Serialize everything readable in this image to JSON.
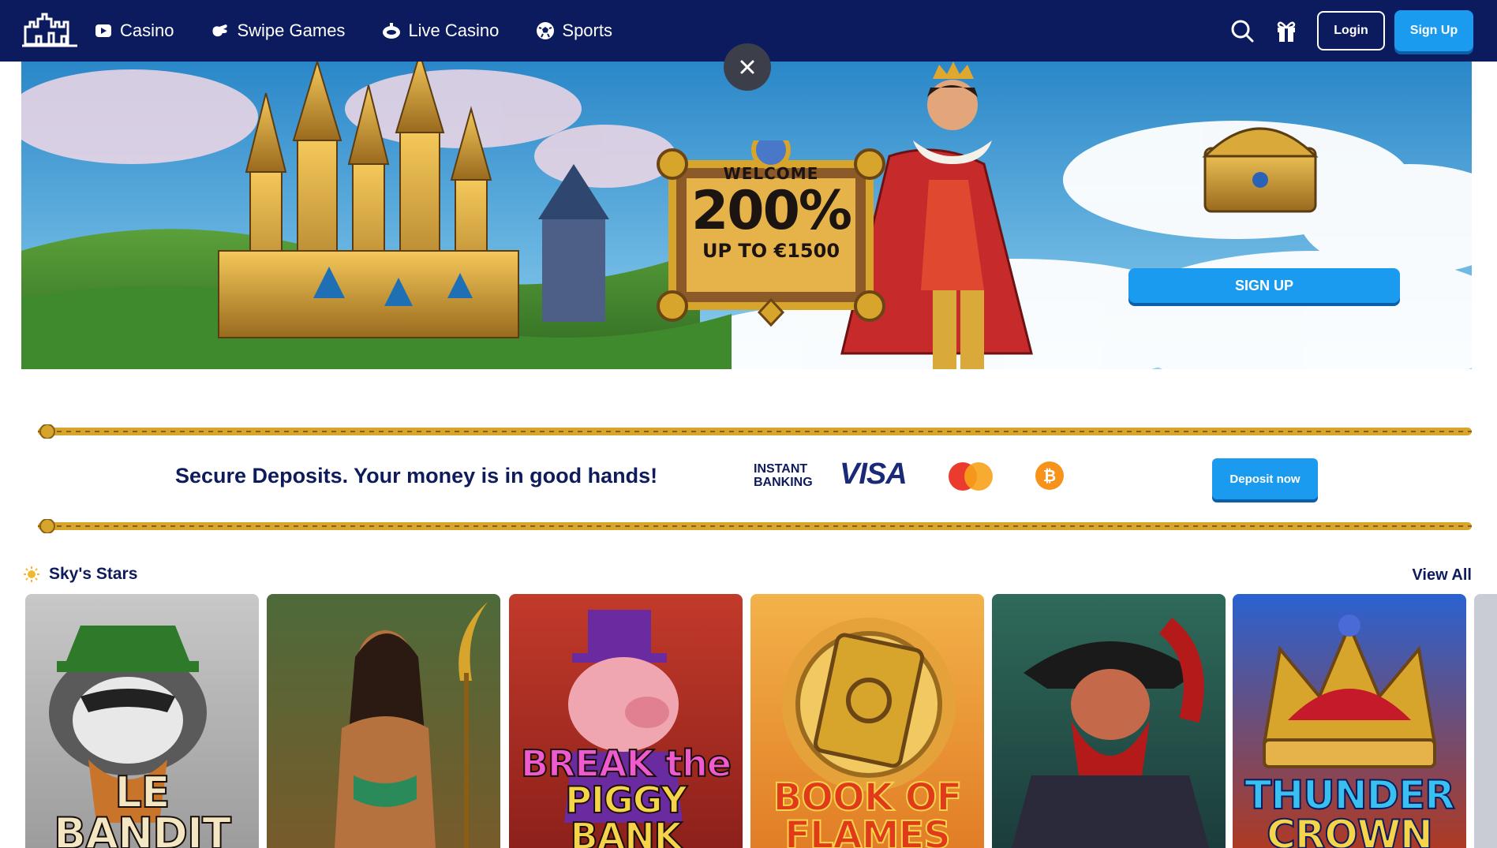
{
  "header": {
    "nav": [
      {
        "label": "Casino",
        "icon": "casino-play-icon"
      },
      {
        "label": "Swipe Games",
        "icon": "swipe-hand-icon"
      },
      {
        "label": "Live Casino",
        "icon": "live-casino-icon"
      },
      {
        "label": "Sports",
        "icon": "soccer-ball-icon"
      }
    ],
    "login_label": "Login",
    "signup_label": "Sign Up"
  },
  "hero": {
    "welcome": "WELCOME",
    "percent": "200%",
    "upto": "UP TO €1500",
    "cta": "SIGN UP"
  },
  "deposit": {
    "message": "Secure Deposits. Your money is in good hands!",
    "instant_line1": "INSTANT",
    "instant_line2": "BANKING",
    "visa": "VISA",
    "button": "Deposit now"
  },
  "games_section": {
    "title": "Sky's Stars",
    "view_all": "View All",
    "games": [
      {
        "title_line1": "LE BANDIT",
        "title_line2": ""
      },
      {
        "title_line1": "",
        "title_line2": ""
      },
      {
        "title_line1": "BREAK the",
        "title_line2": "PIGGY BANK"
      },
      {
        "title_line1": "BOOK OF",
        "title_line2": "FLAMES"
      },
      {
        "title_line1": "",
        "title_line2": ""
      },
      {
        "title_line1": "THUNDER",
        "title_line2": "CROWN"
      }
    ]
  },
  "colors": {
    "header_bg": "#0c1b5e",
    "accent": "#1a9bf0",
    "text_dark": "#0f1c5c",
    "gold": "#d8a52c"
  }
}
